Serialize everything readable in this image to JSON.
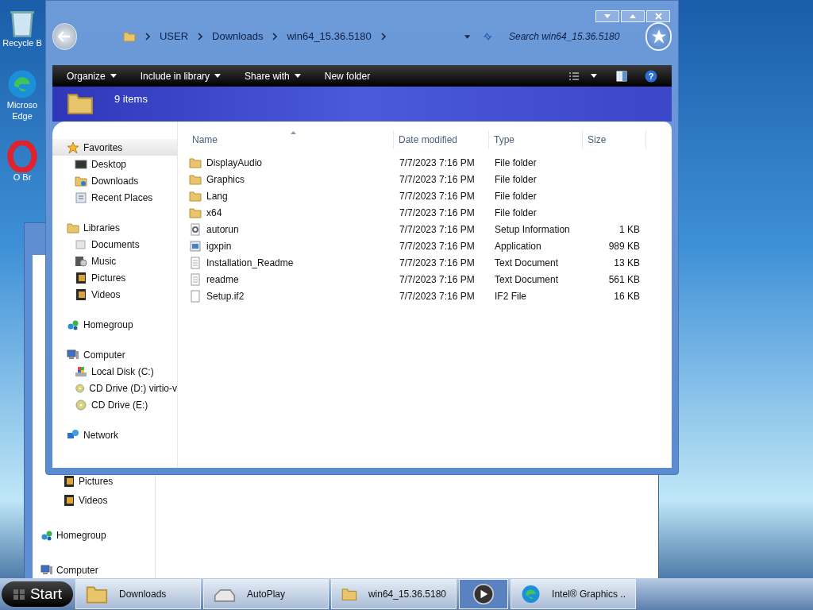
{
  "desktop_icons": [
    {
      "kind": "recycle",
      "label": "Recycle B"
    },
    {
      "kind": "edge",
      "label": "Microso Edge"
    },
    {
      "kind": "opera",
      "label": "O Br"
    }
  ],
  "background_window": {
    "sidebar": [
      {
        "kind": "pictures",
        "label": "Pictures"
      },
      {
        "kind": "videos",
        "label": "Videos"
      },
      {
        "kind": "homegroup",
        "label": "Homegroup"
      },
      {
        "kind": "computer",
        "label": "Computer"
      }
    ]
  },
  "window": {
    "breadcrumb": [
      "USER",
      "Downloads",
      "win64_15.36.5180"
    ],
    "search": {
      "placeholder": "Search win64_15.36.5180"
    },
    "toolbar": [
      {
        "label": "Organize",
        "dropdown": true
      },
      {
        "label": "Include in library",
        "dropdown": true
      },
      {
        "label": "Share with",
        "dropdown": true
      },
      {
        "label": "New folder",
        "dropdown": false
      }
    ],
    "item_count": "9 items",
    "sidebar": [
      {
        "kind": "star",
        "label": "Favorites",
        "selected": true,
        "children": [
          {
            "kind": "desktop",
            "label": "Desktop",
            "selected": false
          },
          {
            "kind": "downloads",
            "label": "Downloads",
            "selected": false
          },
          {
            "kind": "recent",
            "label": "Recent Places",
            "selected": false
          }
        ]
      },
      {
        "kind": "library",
        "label": "Libraries",
        "selected": false,
        "children": [
          {
            "kind": "documents",
            "label": "Documents",
            "selected": false
          },
          {
            "kind": "music",
            "label": "Music",
            "selected": false
          },
          {
            "kind": "pictures",
            "label": "Pictures",
            "selected": false
          },
          {
            "kind": "videos",
            "label": "Videos",
            "selected": false
          }
        ]
      },
      {
        "kind": "homegroup",
        "label": "Homegroup",
        "selected": false
      },
      {
        "kind": "computer",
        "label": "Computer",
        "selected": false,
        "children": [
          {
            "kind": "disk",
            "label": "Local Disk (C:)",
            "selected": false
          },
          {
            "kind": "cd",
            "label": "CD Drive (D:) virtio-v",
            "selected": false
          },
          {
            "kind": "cd",
            "label": "CD Drive (E:)",
            "selected": false
          }
        ]
      },
      {
        "kind": "network",
        "label": "Network",
        "selected": false
      }
    ],
    "help": "?",
    "columns": [
      {
        "label": "Name",
        "sorted": true
      },
      {
        "label": "Date modified",
        "sorted": false
      },
      {
        "label": "Type",
        "sorted": false
      },
      {
        "label": "Size",
        "sorted": false
      }
    ],
    "rows": [
      {
        "kind": "folder",
        "name": "DisplayAudio",
        "date": "7/7/2023 7:16 PM",
        "type": "File folder"
      },
      {
        "kind": "folder",
        "name": "Graphics",
        "date": "7/7/2023 7:16 PM",
        "type": "File folder"
      },
      {
        "kind": "folder",
        "name": "Lang",
        "date": "7/7/2023 7:16 PM",
        "type": "File folder"
      },
      {
        "kind": "folder",
        "name": "x64",
        "date": "7/7/2023 7:16 PM",
        "type": "File folder"
      },
      {
        "kind": "setup",
        "name": "autorun",
        "date": "7/7/2023 7:16 PM",
        "type": "Setup Information",
        "size": "1 KB"
      },
      {
        "kind": "app",
        "name": "igxpin",
        "date": "7/7/2023 7:16 PM",
        "type": "Application",
        "size": "989 KB"
      },
      {
        "kind": "text",
        "name": "Installation_Readme",
        "date": "7/7/2023 7:16 PM",
        "type": "Text Document",
        "size": "13 KB"
      },
      {
        "kind": "text",
        "name": "readme",
        "date": "7/7/2023 7:16 PM",
        "type": "Text Document",
        "size": "561 KB"
      },
      {
        "kind": "file",
        "name": "Setup.if2",
        "date": "7/7/2023 7:16 PM",
        "type": "IF2 File",
        "size": "16 KB"
      }
    ]
  },
  "taskbar": {
    "start": "Start",
    "buttons": [
      {
        "kind": "folder",
        "label": "Downloads",
        "selected": false
      },
      {
        "kind": "drive",
        "label": "AutoPlay",
        "selected": false
      },
      {
        "kind": "folder",
        "label": "win64_15.36.5180",
        "selected": false
      },
      {
        "kind": "media",
        "selected": true
      },
      {
        "kind": "edge",
        "label": "Intel® Graphics ..",
        "selected": false
      }
    ]
  }
}
